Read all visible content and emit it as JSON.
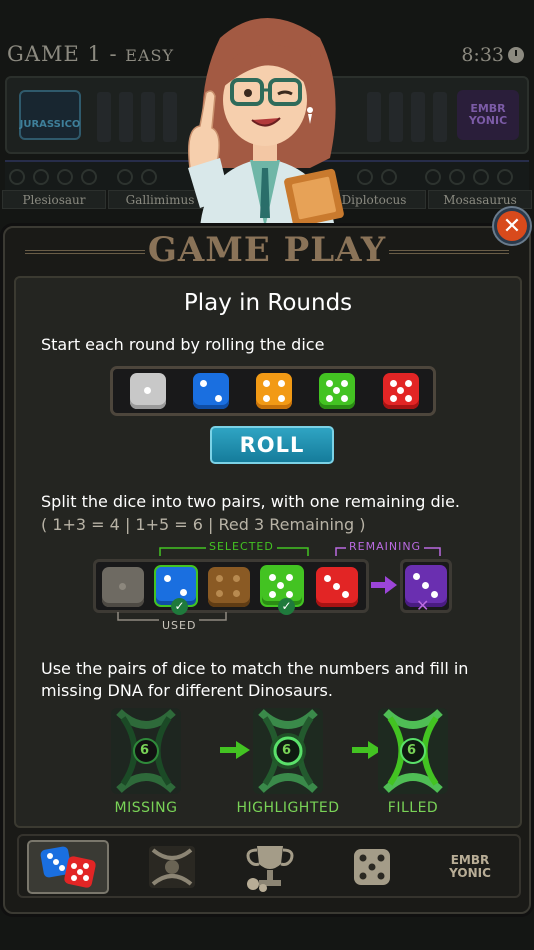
{
  "header": {
    "game_label": "GAME 1",
    "difficulty": "EASY",
    "separator": "-",
    "timer": "8:33"
  },
  "board": {
    "left_logo": "JURASSICO",
    "right_logo": "EMBR YONIC",
    "dinosaurs": [
      "Plesiosaur",
      "Gallimimus",
      "",
      "Diplotocus",
      "Mosasaurus"
    ]
  },
  "modal": {
    "title": "GAME PLAY",
    "close_label": "✕",
    "section_title": "Play in Rounds",
    "step1": "Start each round by rolling the dice",
    "dice": [
      {
        "color": "#c8c8c8",
        "value": 1
      },
      {
        "color": "#1a6fe0",
        "value": 2
      },
      {
        "color": "#f29a15",
        "value": 4
      },
      {
        "color": "#43c322",
        "value": 5
      },
      {
        "color": "#e22525",
        "value": 5
      }
    ],
    "roll_label": "ROLL",
    "step2": "Split the dice into two pairs, with one remaining die.",
    "step2_example": "( 1+3 = 4 | 1+5 = 6 | Red 3 Remaining )",
    "selected_label": "SELECTED",
    "remaining_label": "REMAINING",
    "used_label": "USED",
    "step3": "Use the pairs of dice to match the numbers and fill in missing DNA for different Dinosaurs.",
    "dna_states": [
      {
        "label": "MISSING",
        "number": "6"
      },
      {
        "label": "HIGHLIGHTED",
        "number": "6"
      },
      {
        "label": "FILLED",
        "number": "6"
      }
    ]
  },
  "nav": {
    "items": [
      {
        "name": "dice",
        "active": true
      },
      {
        "name": "dna",
        "active": false
      },
      {
        "name": "trophy",
        "active": false
      },
      {
        "name": "die-single",
        "active": false
      },
      {
        "name": "embryonic",
        "active": false,
        "text": "EMBR YONIC"
      }
    ]
  },
  "colors": {
    "accent_green": "#79d357",
    "title_brown": "#8a7358",
    "close_orange": "#d84a1c",
    "roll_blue": "#2fa4c3",
    "selected_green": "#43c322",
    "remaining_purple": "#b96ae0"
  }
}
